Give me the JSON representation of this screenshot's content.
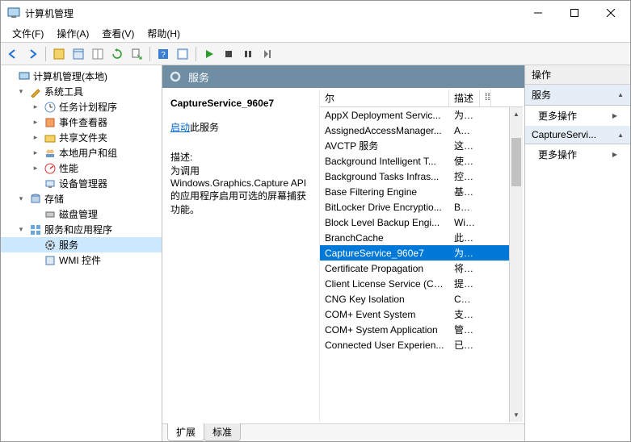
{
  "window": {
    "title": "计算机管理"
  },
  "menu": {
    "file": "文件(F)",
    "action": "操作(A)",
    "view": "查看(V)",
    "help": "帮助(H)"
  },
  "tree": {
    "root": "计算机管理(本地)",
    "system_tools": "系统工具",
    "task_scheduler": "任务计划程序",
    "event_viewer": "事件查看器",
    "shared_folders": "共享文件夹",
    "local_users": "本地用户和组",
    "performance": "性能",
    "device_manager": "设备管理器",
    "storage": "存储",
    "disk_mgmt": "磁盘管理",
    "services_apps": "服务和应用程序",
    "services": "服务",
    "wmi": "WMI 控件"
  },
  "center": {
    "header": "服务",
    "selected_name": "CaptureService_960e7",
    "start_link": "启动",
    "start_suffix": "此服务",
    "desc_label": "描述:",
    "desc_text": "为调用 Windows.Graphics.Capture API 的应用程序启用可选的屏幕捕获功能。",
    "col_name": "尔",
    "col_desc": "描述",
    "col_extra": "⁞⁞"
  },
  "services": [
    {
      "name": "AppX Deployment Servic...",
      "desc": "为部..."
    },
    {
      "name": "AssignedAccessManager...",
      "desc": "Assi..."
    },
    {
      "name": "AVCTP 服务",
      "desc": "这是..."
    },
    {
      "name": "Background Intelligent T...",
      "desc": "使用..."
    },
    {
      "name": "Background Tasks Infras...",
      "desc": "控制..."
    },
    {
      "name": "Base Filtering Engine",
      "desc": "基本..."
    },
    {
      "name": "BitLocker Drive Encryptio...",
      "desc": "BDE..."
    },
    {
      "name": "Block Level Backup Engi...",
      "desc": "Win..."
    },
    {
      "name": "BranchCache",
      "desc": "此服..."
    },
    {
      "name": "CaptureService_960e7",
      "desc": "为调...",
      "selected": true
    },
    {
      "name": "Certificate Propagation",
      "desc": "将用..."
    },
    {
      "name": "Client License Service (Cli...",
      "desc": "提供..."
    },
    {
      "name": "CNG Key Isolation",
      "desc": "CNG..."
    },
    {
      "name": "COM+ Event System",
      "desc": "支持..."
    },
    {
      "name": "COM+ System Application",
      "desc": "管理..."
    },
    {
      "name": "Connected User Experien...",
      "desc": "已连..."
    }
  ],
  "tabs": {
    "extended": "扩展",
    "standard": "标准"
  },
  "actions": {
    "title": "操作",
    "section1": "服务",
    "more1": "更多操作",
    "section2": "CaptureServi...",
    "more2": "更多操作"
  }
}
